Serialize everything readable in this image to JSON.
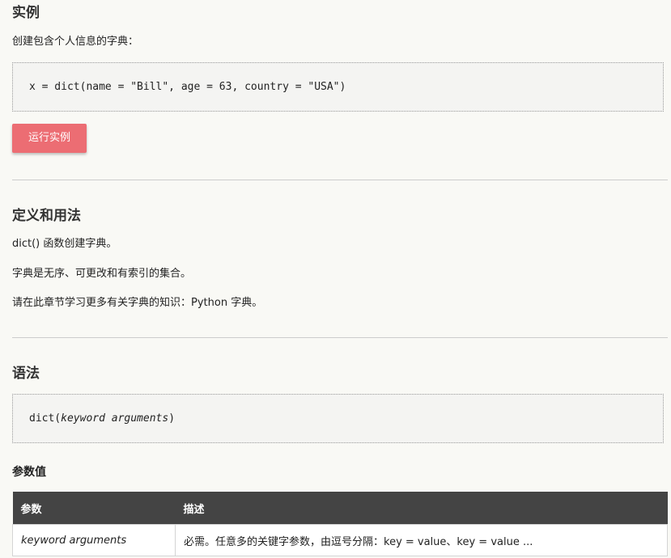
{
  "example": {
    "heading": "实例",
    "intro": "创建包含个人信息的字典：",
    "code": "x = dict(name = \"Bill\", age = 63, country = \"USA\")",
    "run_button": "运行实例"
  },
  "definition": {
    "heading": "定义和用法",
    "p1": "dict() 函数创建字典。",
    "p2": "字典是无序、可更改和有索引的集合。",
    "p3": "请在此章节学习更多有关字典的知识：Python 字典。"
  },
  "syntax": {
    "heading": "语法",
    "code_func": "dict(",
    "code_arg": "keyword arguments",
    "code_close": ")"
  },
  "params": {
    "heading": "参数值",
    "columns": [
      "参数",
      "描述"
    ],
    "rows": [
      {
        "name": "keyword arguments",
        "desc": "必需。任意多的关键字参数，由逗号分隔：key = value、key = value ..."
      }
    ]
  }
}
